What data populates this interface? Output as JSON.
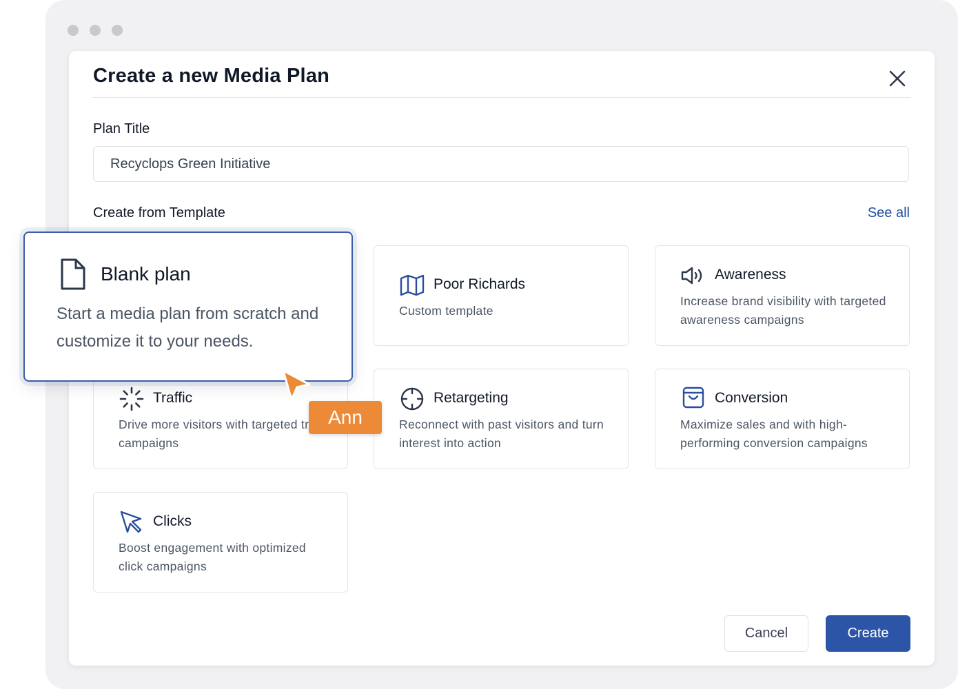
{
  "window": {
    "dots": [
      "#c9c9cd",
      "#c9c9cd",
      "#c9c9cd"
    ]
  },
  "dialog": {
    "title": "Create a new Media Plan",
    "close_icon": "close-icon"
  },
  "plan_title": {
    "label": "Plan Title",
    "value": "Recyclops Green Initiative"
  },
  "templates": {
    "label": "Create from Template",
    "see_all": "See all",
    "blank": {
      "name": "Blank plan",
      "description": "Start a media plan from scratch and customize it to your needs.",
      "icon": "document-icon"
    },
    "items": [
      {
        "name": "Poor Richards",
        "description": "Custom template",
        "icon": "map-icon"
      },
      {
        "name": "Awareness",
        "description": "Increase brand visibility with targeted awareness campaigns",
        "icon": "speaker-icon"
      },
      {
        "name": "Traffic",
        "description": "Drive more visitors with targeted traffic campaigns",
        "icon": "loader-icon"
      },
      {
        "name": "Retargeting",
        "description": "Reconnect with past visitors and turn interest into action",
        "icon": "crosshair-icon"
      },
      {
        "name": "Conversion",
        "description": "Maximize sales and with high-performing conversion campaigns",
        "icon": "shopping-bag-icon"
      },
      {
        "name": "Clicks",
        "description": "Boost engagement with optimized click campaigns",
        "icon": "cursor-click-icon"
      }
    ]
  },
  "actions": {
    "cancel": "Cancel",
    "create": "Create"
  },
  "collaborator": {
    "name": "Ann",
    "color": "#ec8a37"
  },
  "colors": {
    "accent": "#2c55a8",
    "link": "#1e4fa3",
    "icon": "#2b4f9e"
  }
}
